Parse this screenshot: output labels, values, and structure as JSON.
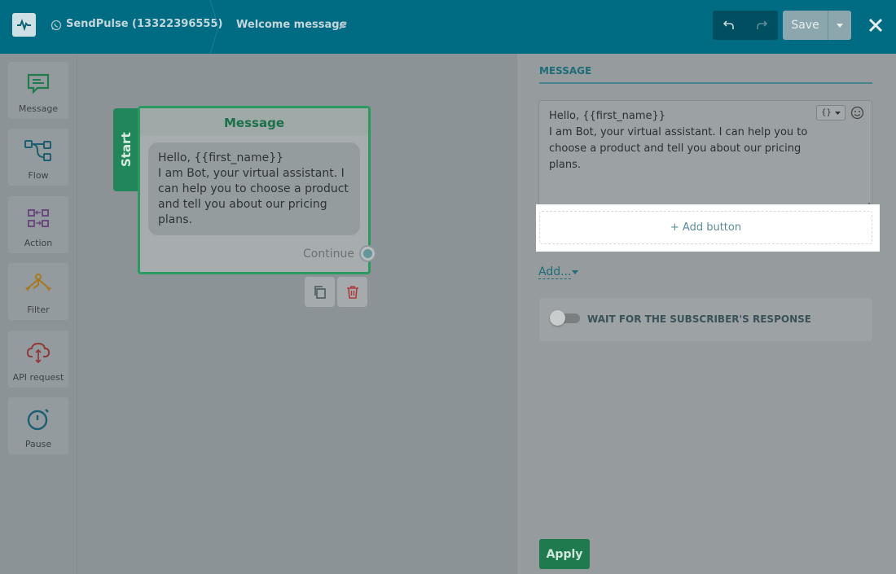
{
  "header": {
    "bot_name": "SendPulse (13322396555)",
    "flow_name": "Welcome message",
    "save_label": "Save"
  },
  "toolbar": {
    "items": [
      {
        "label": "Message",
        "icon": "message-icon",
        "color": "#1f7a4e"
      },
      {
        "label": "Flow",
        "icon": "flow-icon",
        "color": "#1d5f70"
      },
      {
        "label": "Action",
        "icon": "action-icon",
        "color": "#6b4a7d"
      },
      {
        "label": "Filter",
        "icon": "filter-icon",
        "color": "#a9781f"
      },
      {
        "label": "API request",
        "icon": "cloud-icon",
        "color": "#8f3a3a"
      },
      {
        "label": "Pause",
        "icon": "timer-icon",
        "color": "#1d5f70"
      }
    ]
  },
  "canvas": {
    "start_label": "Start",
    "node_title": "Message",
    "node_text": "Hello,  {{first_name}}\nI am Bot, your virtual assistant. I can help you to choose a product and tell you about our pricing plans.",
    "continue_label": "Continue"
  },
  "panel": {
    "heading": "MESSAGE",
    "message_text": "Hello,  {{first_name}}\nI am Bot, your virtual assistant. I can help you to choose a product and tell you about our pricing plans.",
    "variable_button": "{}",
    "add_button_label": "+ Add button",
    "add_link_label": "Add...",
    "wait_label": "WAIT FOR THE SUBSCRIBER'S RESPONSE",
    "wait_enabled": false,
    "apply_label": "Apply"
  },
  "colors": {
    "header_bg": "#006c83",
    "accent_green": "#1f7a4e",
    "link_teal": "#1d6c7a"
  }
}
